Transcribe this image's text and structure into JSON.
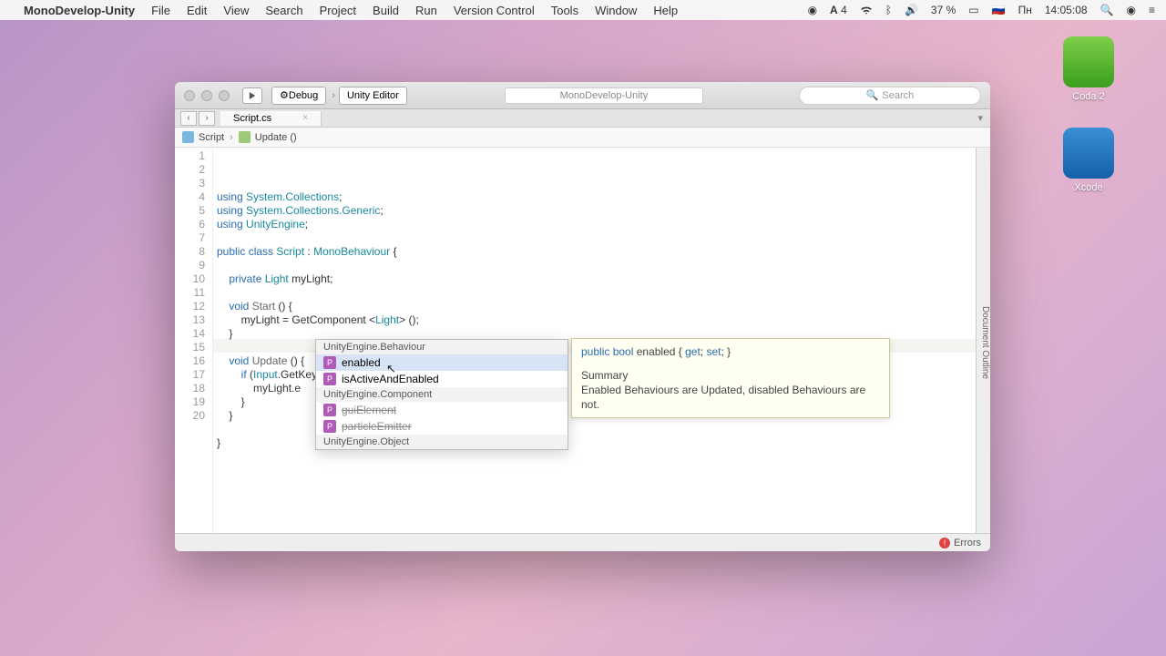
{
  "menubar": {
    "app": "MonoDevelop-Unity",
    "items": [
      "File",
      "Edit",
      "View",
      "Search",
      "Project",
      "Build",
      "Run",
      "Version Control",
      "Tools",
      "Window",
      "Help"
    ],
    "adobe_count": "4",
    "battery": "37 %",
    "flag": "🇷🇺",
    "day": "Пн",
    "time": "14:05:08"
  },
  "desktop": {
    "coda": "Coda 2",
    "xcode": "Xcode"
  },
  "toolbar": {
    "config": "Debug",
    "target": "Unity Editor",
    "center_title": "MonoDevelop-Unity",
    "search_placeholder": "Search"
  },
  "tabs": {
    "file": "Script.cs"
  },
  "breadcrumb": {
    "a": "Script",
    "b": "Update ()"
  },
  "code": {
    "lines": [
      {
        "n": 1,
        "h": "<span class='k-blue'>using</span> <span class='k-teal'>System.Collections</span>;"
      },
      {
        "n": 2,
        "h": "<span class='k-blue'>using</span> <span class='k-teal'>System.Collections.Generic</span>;"
      },
      {
        "n": 3,
        "h": "<span class='k-blue'>using</span> <span class='k-teal'>UnityEngine</span>;"
      },
      {
        "n": 4,
        "h": ""
      },
      {
        "n": 5,
        "h": "<span class='k-blue'>public class</span> <span class='k-teal'>Script</span> : <span class='k-teal'>MonoBehaviour</span> {"
      },
      {
        "n": 6,
        "h": ""
      },
      {
        "n": 7,
        "h": "    <span class='k-blue'>private</span> <span class='k-teal'>Light</span> myLight;"
      },
      {
        "n": 8,
        "h": ""
      },
      {
        "n": 9,
        "h": "    <span class='k-blue'>void</span> <span class='k-gray'>Start</span> () {"
      },
      {
        "n": 10,
        "h": "        myLight = GetComponent &lt;<span class='k-teal'>Light</span>&gt; ();"
      },
      {
        "n": 11,
        "h": "    }"
      },
      {
        "n": 12,
        "h": ""
      },
      {
        "n": 13,
        "h": "    <span class='k-blue'>void</span> <span class='k-gray'>Update</span> () {"
      },
      {
        "n": 14,
        "h": "        <span class='k-blue'>if</span> (<span class='k-teal'>Input</span>.GetKeyUp (<span class='k-teal'>KeyCode</span>.<span class='k-orange'>Space</span>)) {"
      },
      {
        "n": 15,
        "h": "            myLight.e"
      },
      {
        "n": 16,
        "h": "        }"
      },
      {
        "n": 17,
        "h": "    }"
      },
      {
        "n": 18,
        "h": ""
      },
      {
        "n": 19,
        "h": "}"
      },
      {
        "n": 20,
        "h": ""
      }
    ]
  },
  "popup": {
    "g1": "UnityEngine.Behaviour",
    "i1": "enabled",
    "i2": "isActiveAndEnabled",
    "g2": "UnityEngine.Component",
    "i3": "guiElement",
    "i4": "particleEmitter",
    "g3": "UnityEngine.Object"
  },
  "tooltip": {
    "sig_html": "<span class='kw'>public</span> <span class='kw'>bool</span> enabled { <span class='kw'>get</span>; <span class='kw'>set</span>; }",
    "summary_label": "Summary",
    "summary_text": "Enabled Behaviours are Updated, disabled Behaviours are not."
  },
  "outline": "Document Outline",
  "statusbar": {
    "errors": "Errors"
  }
}
